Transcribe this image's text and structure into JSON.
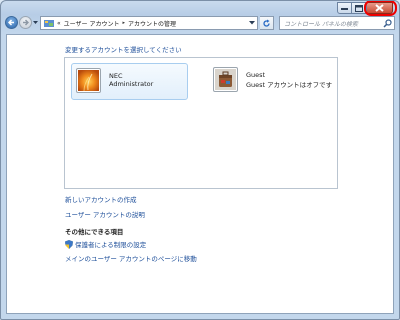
{
  "window": {
    "accent_close": "#c84a33",
    "highlight_ring": "#e00000"
  },
  "address_bar": {
    "prefix": "«",
    "crumbs": [
      "ユーザー アカウント",
      "アカウントの管理"
    ],
    "separator": "▸"
  },
  "search": {
    "placeholder": "コントロール パネルの検索"
  },
  "main": {
    "prompt": "変更するアカウントを選択してください",
    "accounts": [
      {
        "name": "NEC",
        "role": "Administrator",
        "icon": "orange-flower-avatar"
      },
      {
        "name": "Guest",
        "role": "Guest アカウントはオフです",
        "icon": "guest-suitcase-avatar"
      }
    ],
    "links": [
      "新しいアカウントの作成",
      "ユーザー アカウントの説明"
    ],
    "other_title": "その他にできる項目",
    "other_links": [
      "保護者による制限の設定",
      "メインのユーザー アカウントのページに移動"
    ]
  }
}
